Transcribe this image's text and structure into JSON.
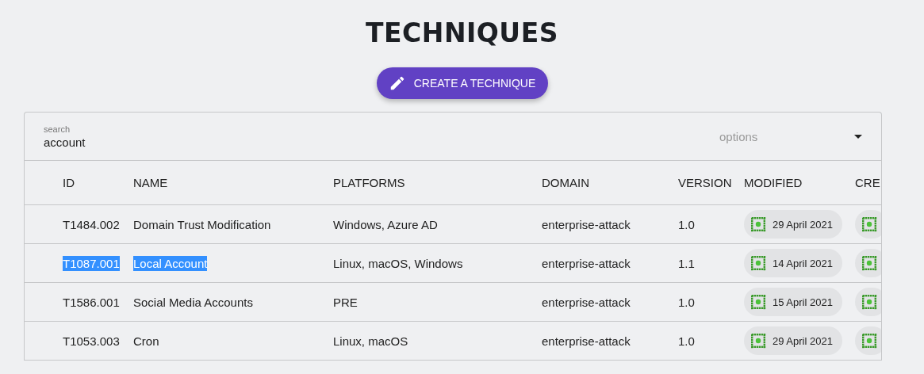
{
  "page": {
    "title": "TECHNIQUES"
  },
  "create_button": {
    "label": "CREATE A TECHNIQUE"
  },
  "search": {
    "label": "search",
    "value": "account"
  },
  "options": {
    "placeholder": "options"
  },
  "table": {
    "columns": [
      "ID",
      "NAME",
      "PLATFORMS",
      "DOMAIN",
      "VERSION",
      "MODIFIED",
      "CRE"
    ],
    "rows": [
      {
        "id": "T1484.002",
        "name": "Domain Trust Modification",
        "platforms": "Windows, Azure AD",
        "domain": "enterprise-attack",
        "version": "1.0",
        "modified": "29 April 2021",
        "text_selected": false
      },
      {
        "id": "T1087.001",
        "name": "Local Account",
        "platforms": "Linux, macOS, Windows",
        "domain": "enterprise-attack",
        "version": "1.1",
        "modified": "14 April 2021",
        "text_selected": true
      },
      {
        "id": "T1586.001",
        "name": "Social Media Accounts",
        "platforms": "PRE",
        "domain": "enterprise-attack",
        "version": "1.0",
        "modified": "15 April 2021",
        "text_selected": false
      },
      {
        "id": "T1053.003",
        "name": "Cron",
        "platforms": "Linux, macOS",
        "domain": "enterprise-attack",
        "version": "1.0",
        "modified": "29 April 2021",
        "text_selected": false
      }
    ]
  }
}
